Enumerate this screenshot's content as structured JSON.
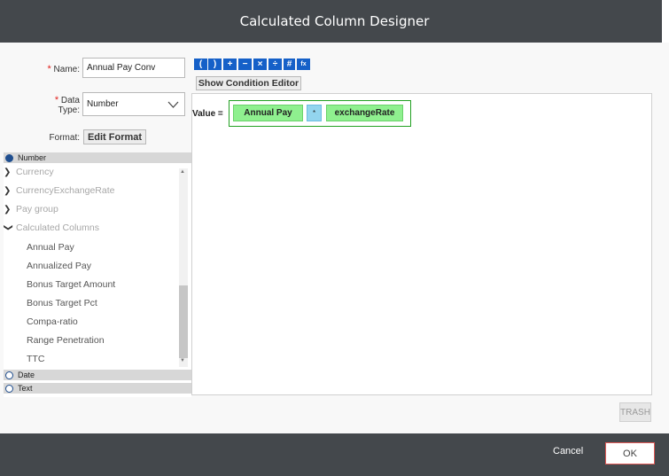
{
  "dialog": {
    "title": "Calculated Column Designer"
  },
  "form": {
    "name_label": "Name:",
    "name_value": "Annual Pay Conv",
    "datatype_label_1": "Data",
    "datatype_label_2": "Type:",
    "datatype_value": "Number",
    "format_label": "Format:",
    "edit_format_button": "Edit Format",
    "required_mark": "*"
  },
  "tree": {
    "number_group": "Number",
    "date_group": "Date",
    "text_group": "Text",
    "folders": [
      "Currency",
      "CurrencyExchangeRate",
      "Pay group",
      "Calculated Columns"
    ],
    "columns": [
      "Annual Pay",
      "Annualized Pay",
      "Bonus Target Amount",
      "Bonus Target Pct",
      "Compa-ratio",
      "Range Penetration",
      "TTC"
    ]
  },
  "toolbar": {
    "tools": [
      "(",
      ")",
      "+",
      "−",
      "×",
      "÷",
      "#",
      "fx"
    ],
    "show_condition_editor": "Show Condition Editor"
  },
  "expression": {
    "value_label": "Value =",
    "left_operand": "Annual Pay",
    "operator": "*",
    "right_operand": "exchangeRate"
  },
  "actions": {
    "trash": "TRASH",
    "cancel": "Cancel",
    "ok": "OK"
  },
  "colors": {
    "titlebar": "#44484c",
    "operand": "#8ff08f",
    "operator": "#93d5ee",
    "tool": "#1560c8",
    "required": "#e0201c"
  }
}
